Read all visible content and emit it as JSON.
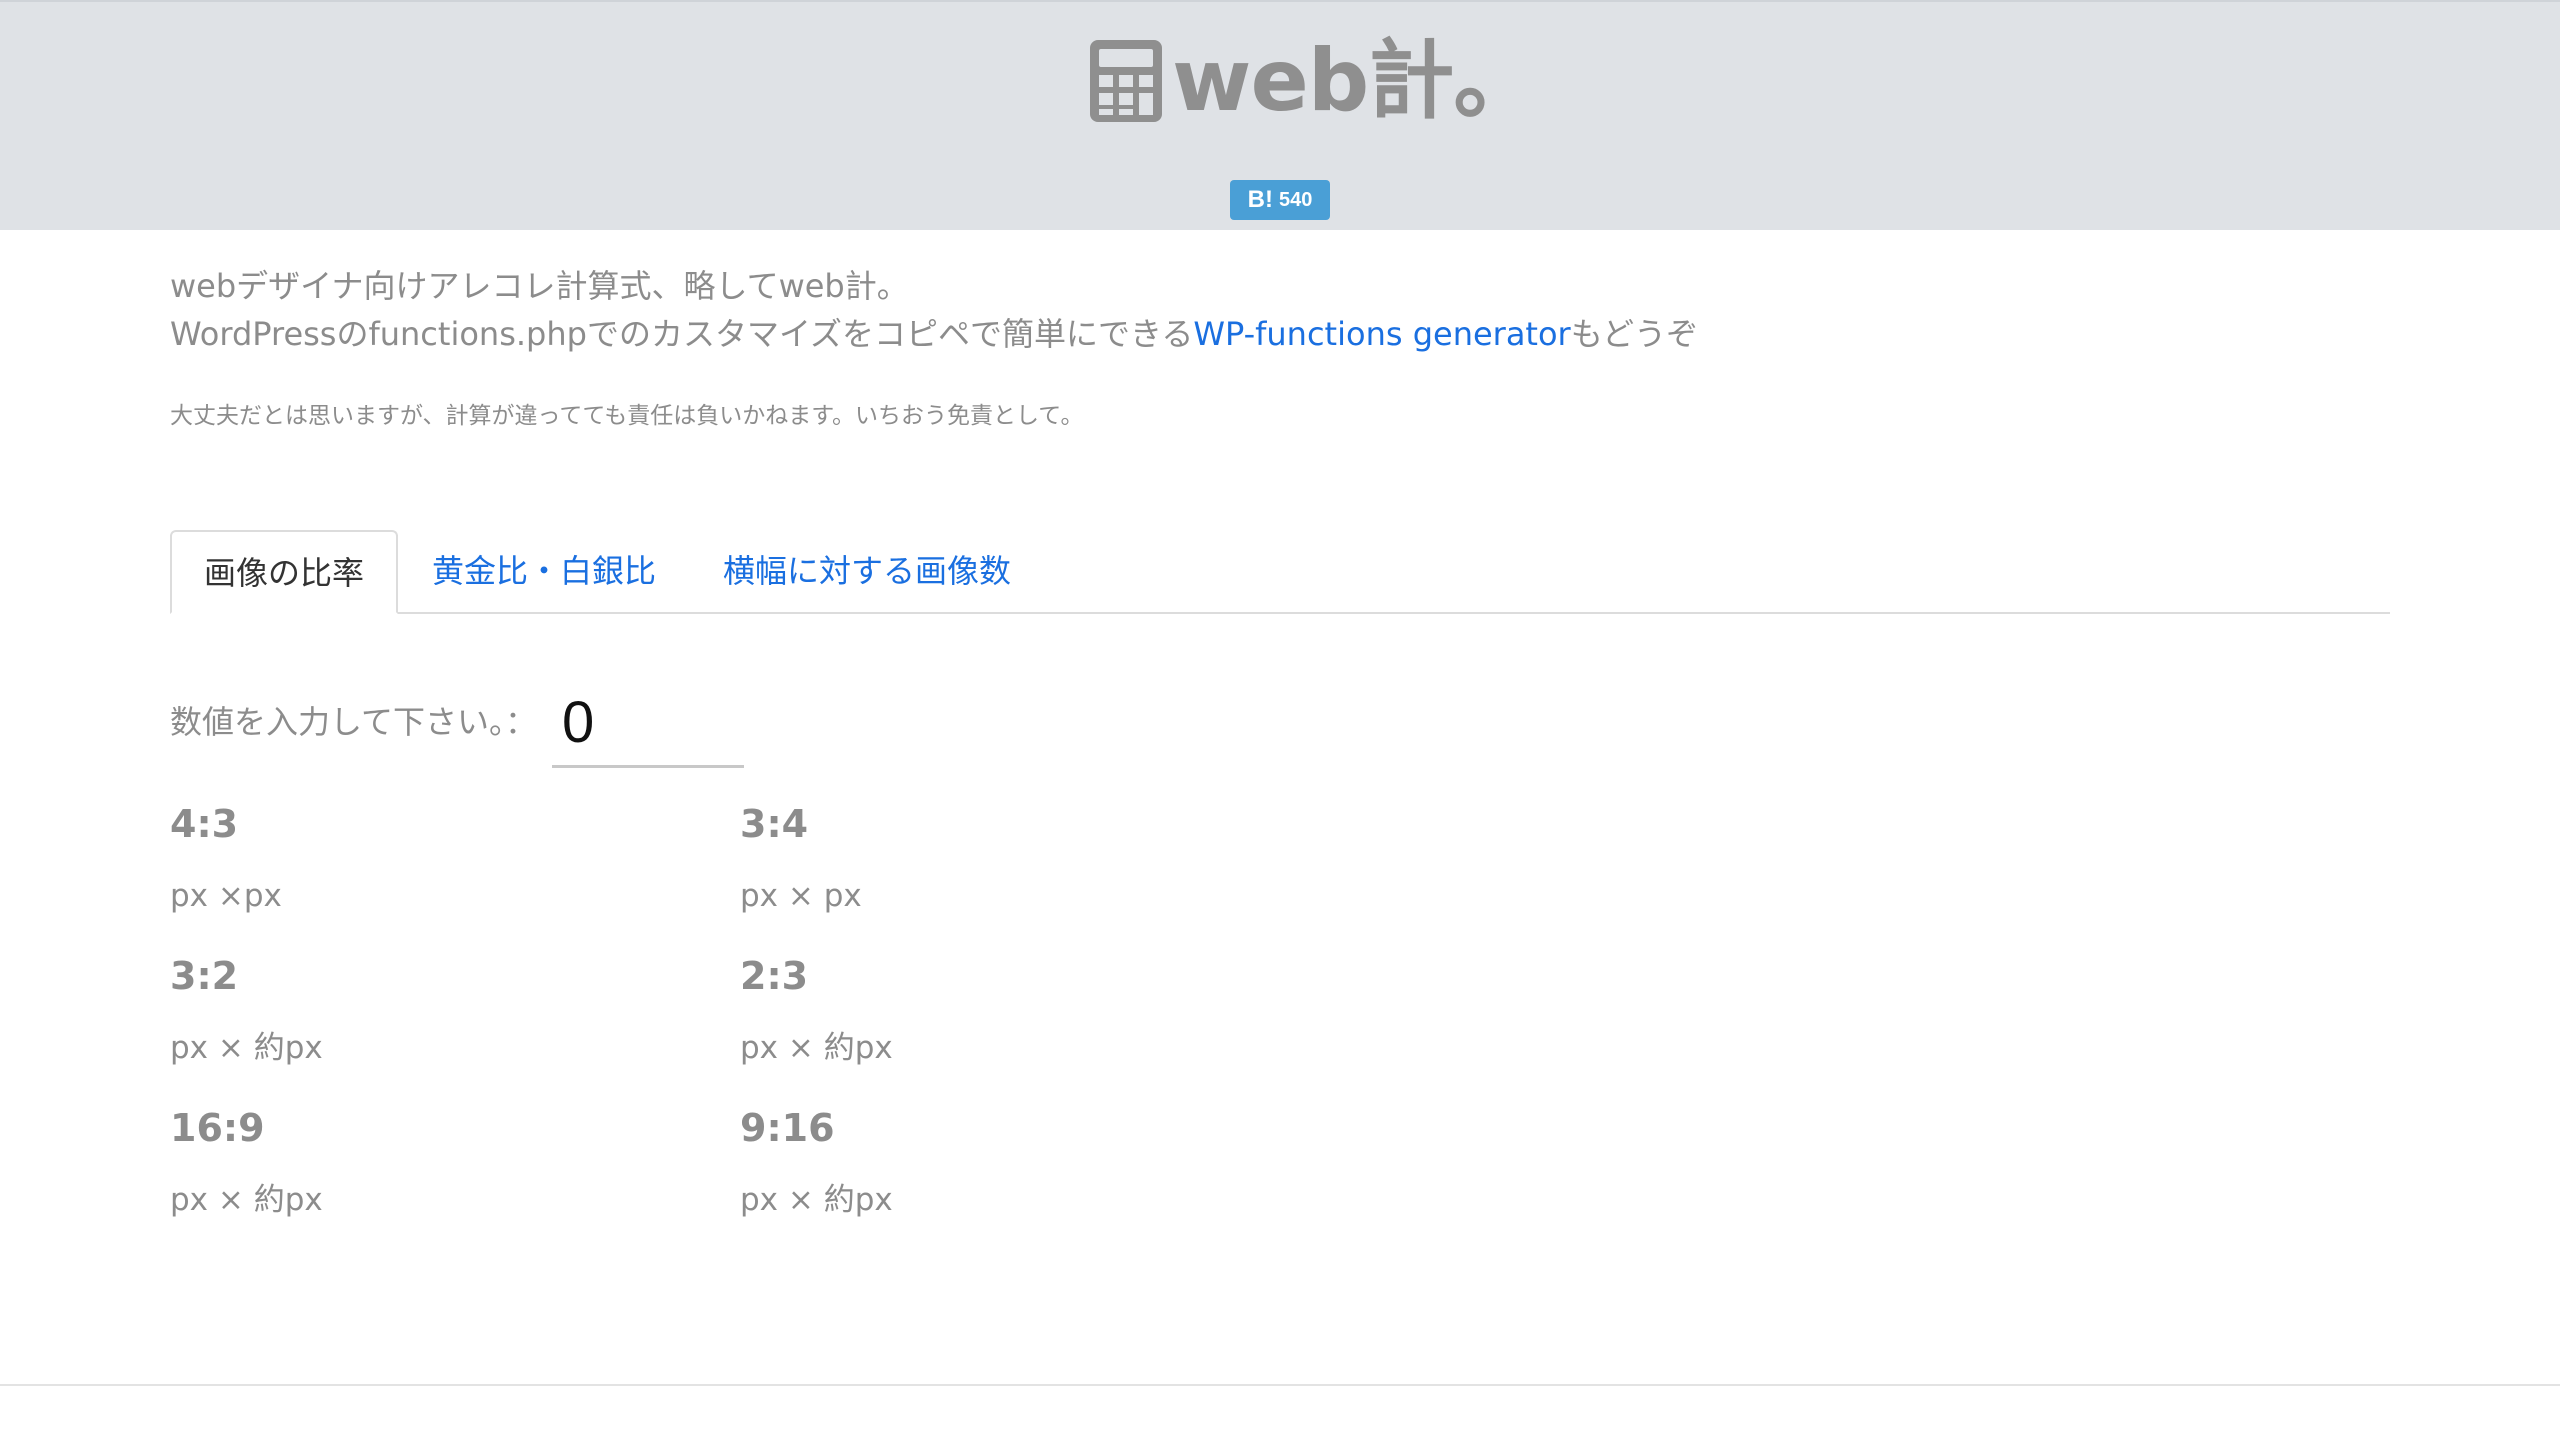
{
  "header": {
    "logo_text": "web計。",
    "hatena_label": "B!",
    "hatena_count": "540"
  },
  "intro": {
    "line1": "webデザイナ向けアレコレ計算式、略してweb計。",
    "line2_before": "WordPressのfunctions.phpでのカスタマイズをコピペで簡単にできる",
    "line2_link": "WP-functions generator",
    "line2_after": "もどうぞ",
    "disclaimer": "大丈夫だとは思いますが、計算が違ってても責任は負いかねます。いちおう免責として。"
  },
  "tabs": [
    {
      "label": "画像の比率",
      "active": true
    },
    {
      "label": "黄金比・白銀比",
      "active": false
    },
    {
      "label": "横幅に対する画像数",
      "active": false
    }
  ],
  "input": {
    "label": "数値を入力して下さい。：",
    "value": "0"
  },
  "ratios": [
    {
      "title": "4:3",
      "value": "px ×px"
    },
    {
      "title": "3:4",
      "value": "px × px"
    },
    {
      "title": "3:2",
      "value": "px × 約px"
    },
    {
      "title": "2:3",
      "value": "px × 約px"
    },
    {
      "title": "16:9",
      "value": "px × 約px"
    },
    {
      "title": "9:16",
      "value": "px × 約px"
    }
  ],
  "colors": {
    "header_bg": "#dfe2e6",
    "logo_gray": "#8f8f8f",
    "hatena_blue": "#4a9fd6",
    "link_blue": "#1a6fe0",
    "text_gray": "#8c8c8c"
  },
  "icons": {
    "logo": "calculator-icon"
  }
}
